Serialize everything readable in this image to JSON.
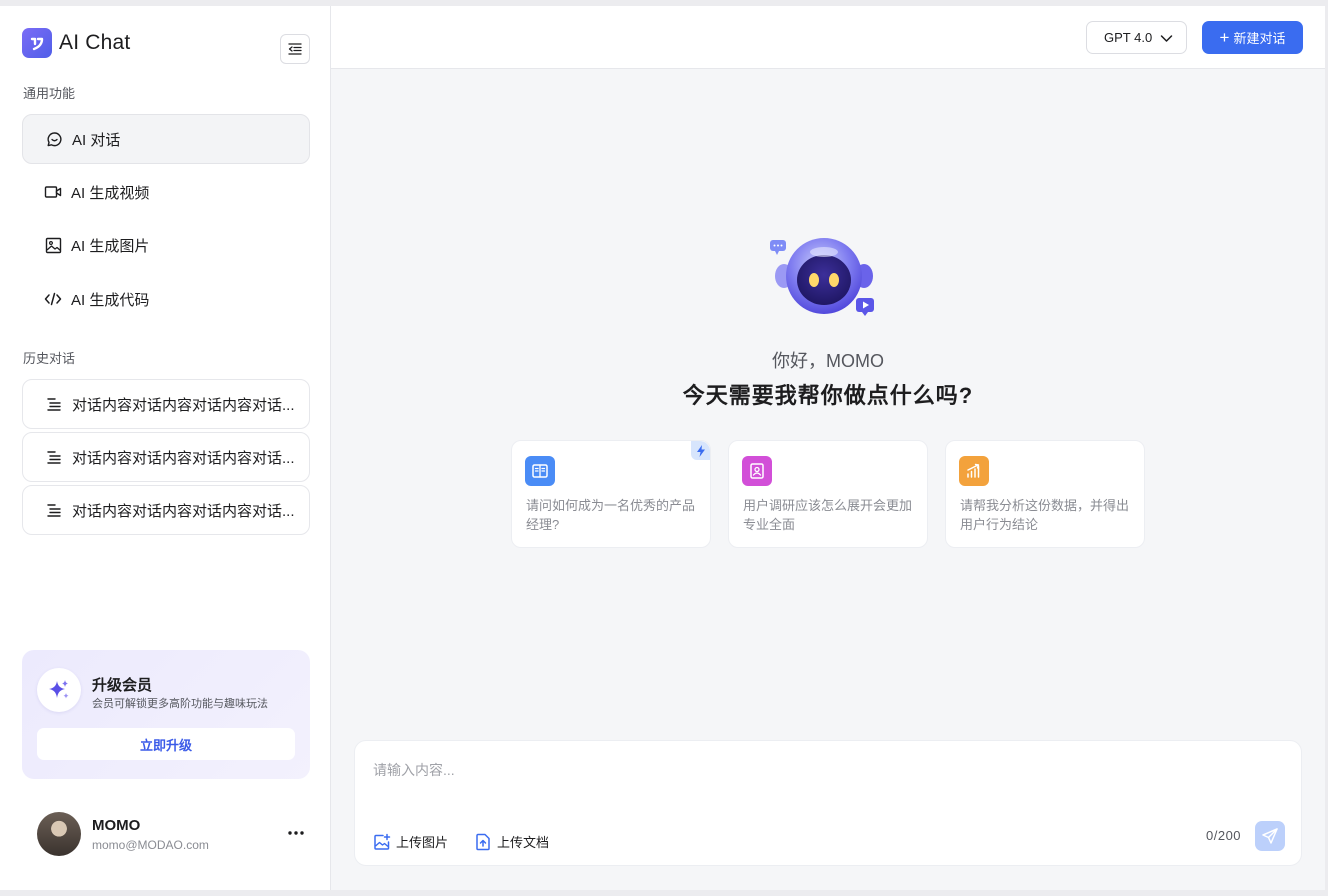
{
  "app": {
    "title": "AI Chat"
  },
  "sidebar": {
    "section_general": "通用功能",
    "nav": [
      {
        "label": "AI 对话",
        "icon": "chat-bubble-icon",
        "active": true
      },
      {
        "label": "AI 生成视频",
        "icon": "video-icon"
      },
      {
        "label": "AI 生成图片",
        "icon": "image-icon"
      },
      {
        "label": "AI 生成代码",
        "icon": "code-icon"
      }
    ],
    "section_history": "历史对话",
    "history": [
      {
        "label": "对话内容对话内容对话内容对话..."
      },
      {
        "label": "对话内容对话内容对话内容对话..."
      },
      {
        "label": "对话内容对话内容对话内容对话..."
      }
    ],
    "upgrade": {
      "title": "升级会员",
      "desc": "会员可解锁更多高阶功能与趣味玩法",
      "button": "立即升级"
    },
    "user": {
      "name": "MOMO",
      "email": "momo@MODAO.com"
    }
  },
  "topbar": {
    "model": "GPT 4.0",
    "new_chat": "新建对话"
  },
  "welcome": {
    "greeting": "你好，MOMO",
    "question": "今天需要我帮你做点什么吗?"
  },
  "cards": [
    {
      "text": "请问如何成为一名优秀的产品经理?",
      "icon": "book-icon",
      "color": "#4a8cf6"
    },
    {
      "text": "用户调研应该怎么展开会更加专业全面",
      "icon": "profile-icon",
      "color": "#d24fd8"
    },
    {
      "text": "请帮我分析这份数据，并得出用户行为结论",
      "icon": "chart-icon",
      "color": "#f3a23c"
    }
  ],
  "composer": {
    "placeholder": "请输入内容...",
    "upload_image": "上传图片",
    "upload_doc": "上传文档",
    "counter": "0/200"
  },
  "colors": {
    "accent": "#3a6cf0",
    "brand_purple": "#6b63f0"
  }
}
